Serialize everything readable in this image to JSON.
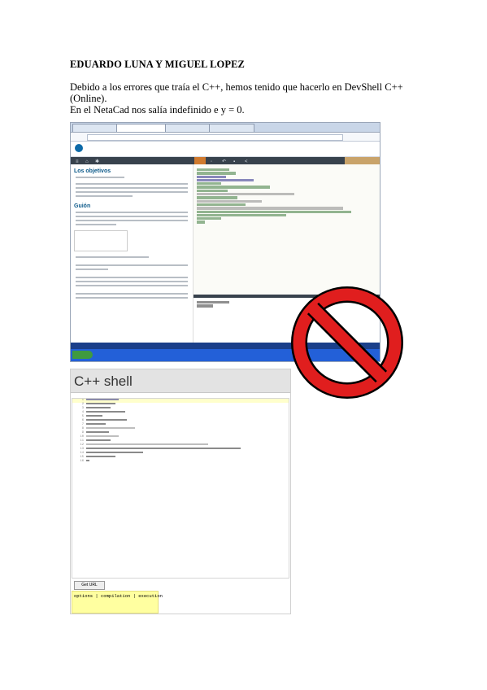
{
  "doc": {
    "title": "EDUARDO LUNA Y MIGUEL LOPEZ",
    "paragraph_line1": "Debido a los errores que traía el C++, hemos tenido que hacerlo en DevShell C++ (Online).",
    "paragraph_line2": "En el NetaCad nos salía indefinido e y = 0."
  },
  "screenshot1": {
    "objectives_heading": "Los objetivos",
    "guide_heading": "Guión"
  },
  "screenshot2": {
    "app_title": "C++ shell",
    "run_button": "Get URL",
    "output_tabs": "options | compilation | execution"
  },
  "colors": {
    "sign_red": "#e01e1e",
    "toolbar_dark": "#38424d"
  }
}
